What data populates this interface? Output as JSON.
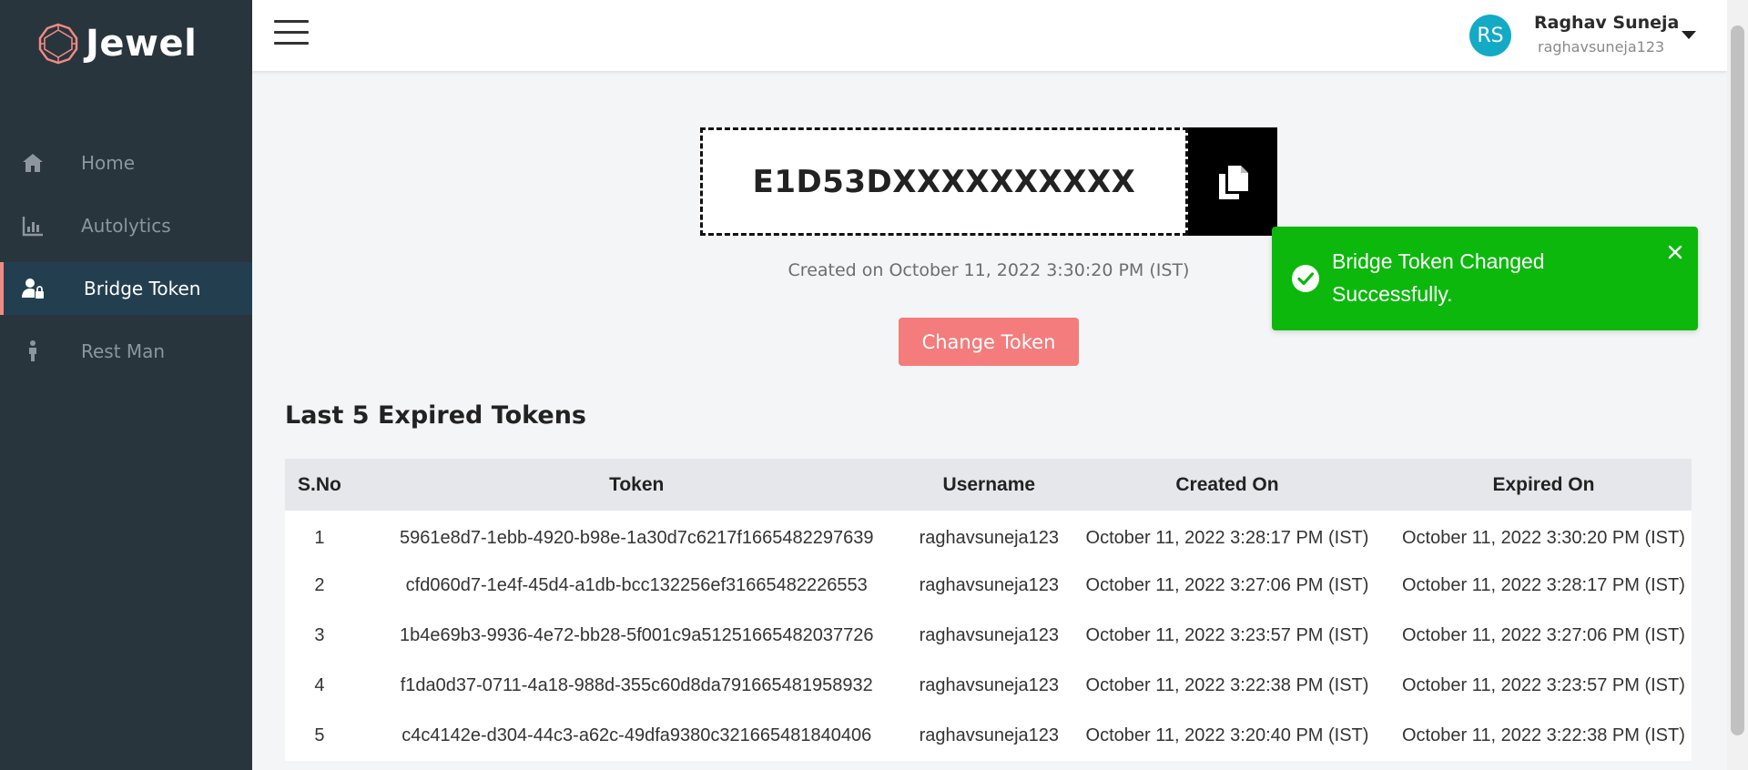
{
  "sidebar": {
    "brand": "Jewel",
    "items": [
      {
        "label": "Home",
        "icon": "home-icon"
      },
      {
        "label": "Autolytics",
        "icon": "bar-chart-icon"
      },
      {
        "label": "Bridge Token",
        "icon": "user-lock-icon",
        "active": true
      },
      {
        "label": "Rest Man",
        "icon": "person-icon"
      }
    ]
  },
  "header": {
    "avatar_initials": "RS",
    "user_name": "Raghav Suneja",
    "user_handle": "raghavsuneja123"
  },
  "token": {
    "value": "E1D53DXXXXXXXXXX",
    "created_on": "Created on October 11, 2022 3:30:20 PM (IST)",
    "change_button": "Change Token"
  },
  "expired": {
    "title": "Last 5 Expired Tokens",
    "columns": [
      "S.No",
      "Token",
      "Username",
      "Created On",
      "Expired On"
    ],
    "rows": [
      [
        "1",
        "5961e8d7-1ebb-4920-b98e-1a30d7c6217f1665482297639",
        "raghavsuneja123",
        "October 11, 2022 3:28:17 PM (IST)",
        "October 11, 2022 3:30:20 PM (IST)"
      ],
      [
        "2",
        "cfd060d7-1e4f-45d4-a1db-bcc132256ef31665482226553",
        "raghavsuneja123",
        "October 11, 2022 3:27:06 PM (IST)",
        "October 11, 2022 3:28:17 PM (IST)"
      ],
      [
        "3",
        "1b4e69b3-9936-4e72-bb28-5f001c9a51251665482037726",
        "raghavsuneja123",
        "October 11, 2022 3:23:57 PM (IST)",
        "October 11, 2022 3:27:06 PM (IST)"
      ],
      [
        "4",
        "f1da0d37-0711-4a18-988d-355c60d8da791665481958932",
        "raghavsuneja123",
        "October 11, 2022 3:22:38 PM (IST)",
        "October 11, 2022 3:23:57 PM (IST)"
      ],
      [
        "5",
        "c4c4142e-d304-44c3-a62c-49dfa9380c321665481840406",
        "raghavsuneja123",
        "October 11, 2022 3:20:40 PM (IST)",
        "October 11, 2022 3:22:38 PM (IST)"
      ]
    ]
  },
  "toast": {
    "message": "Bridge Token Changed Successfully."
  },
  "colors": {
    "sidebar_bg": "#28353d",
    "accent": "#f08a84",
    "toast_bg": "#0cb80c",
    "avatar_bg": "#13aac6",
    "button_bg": "#f47c7c"
  }
}
